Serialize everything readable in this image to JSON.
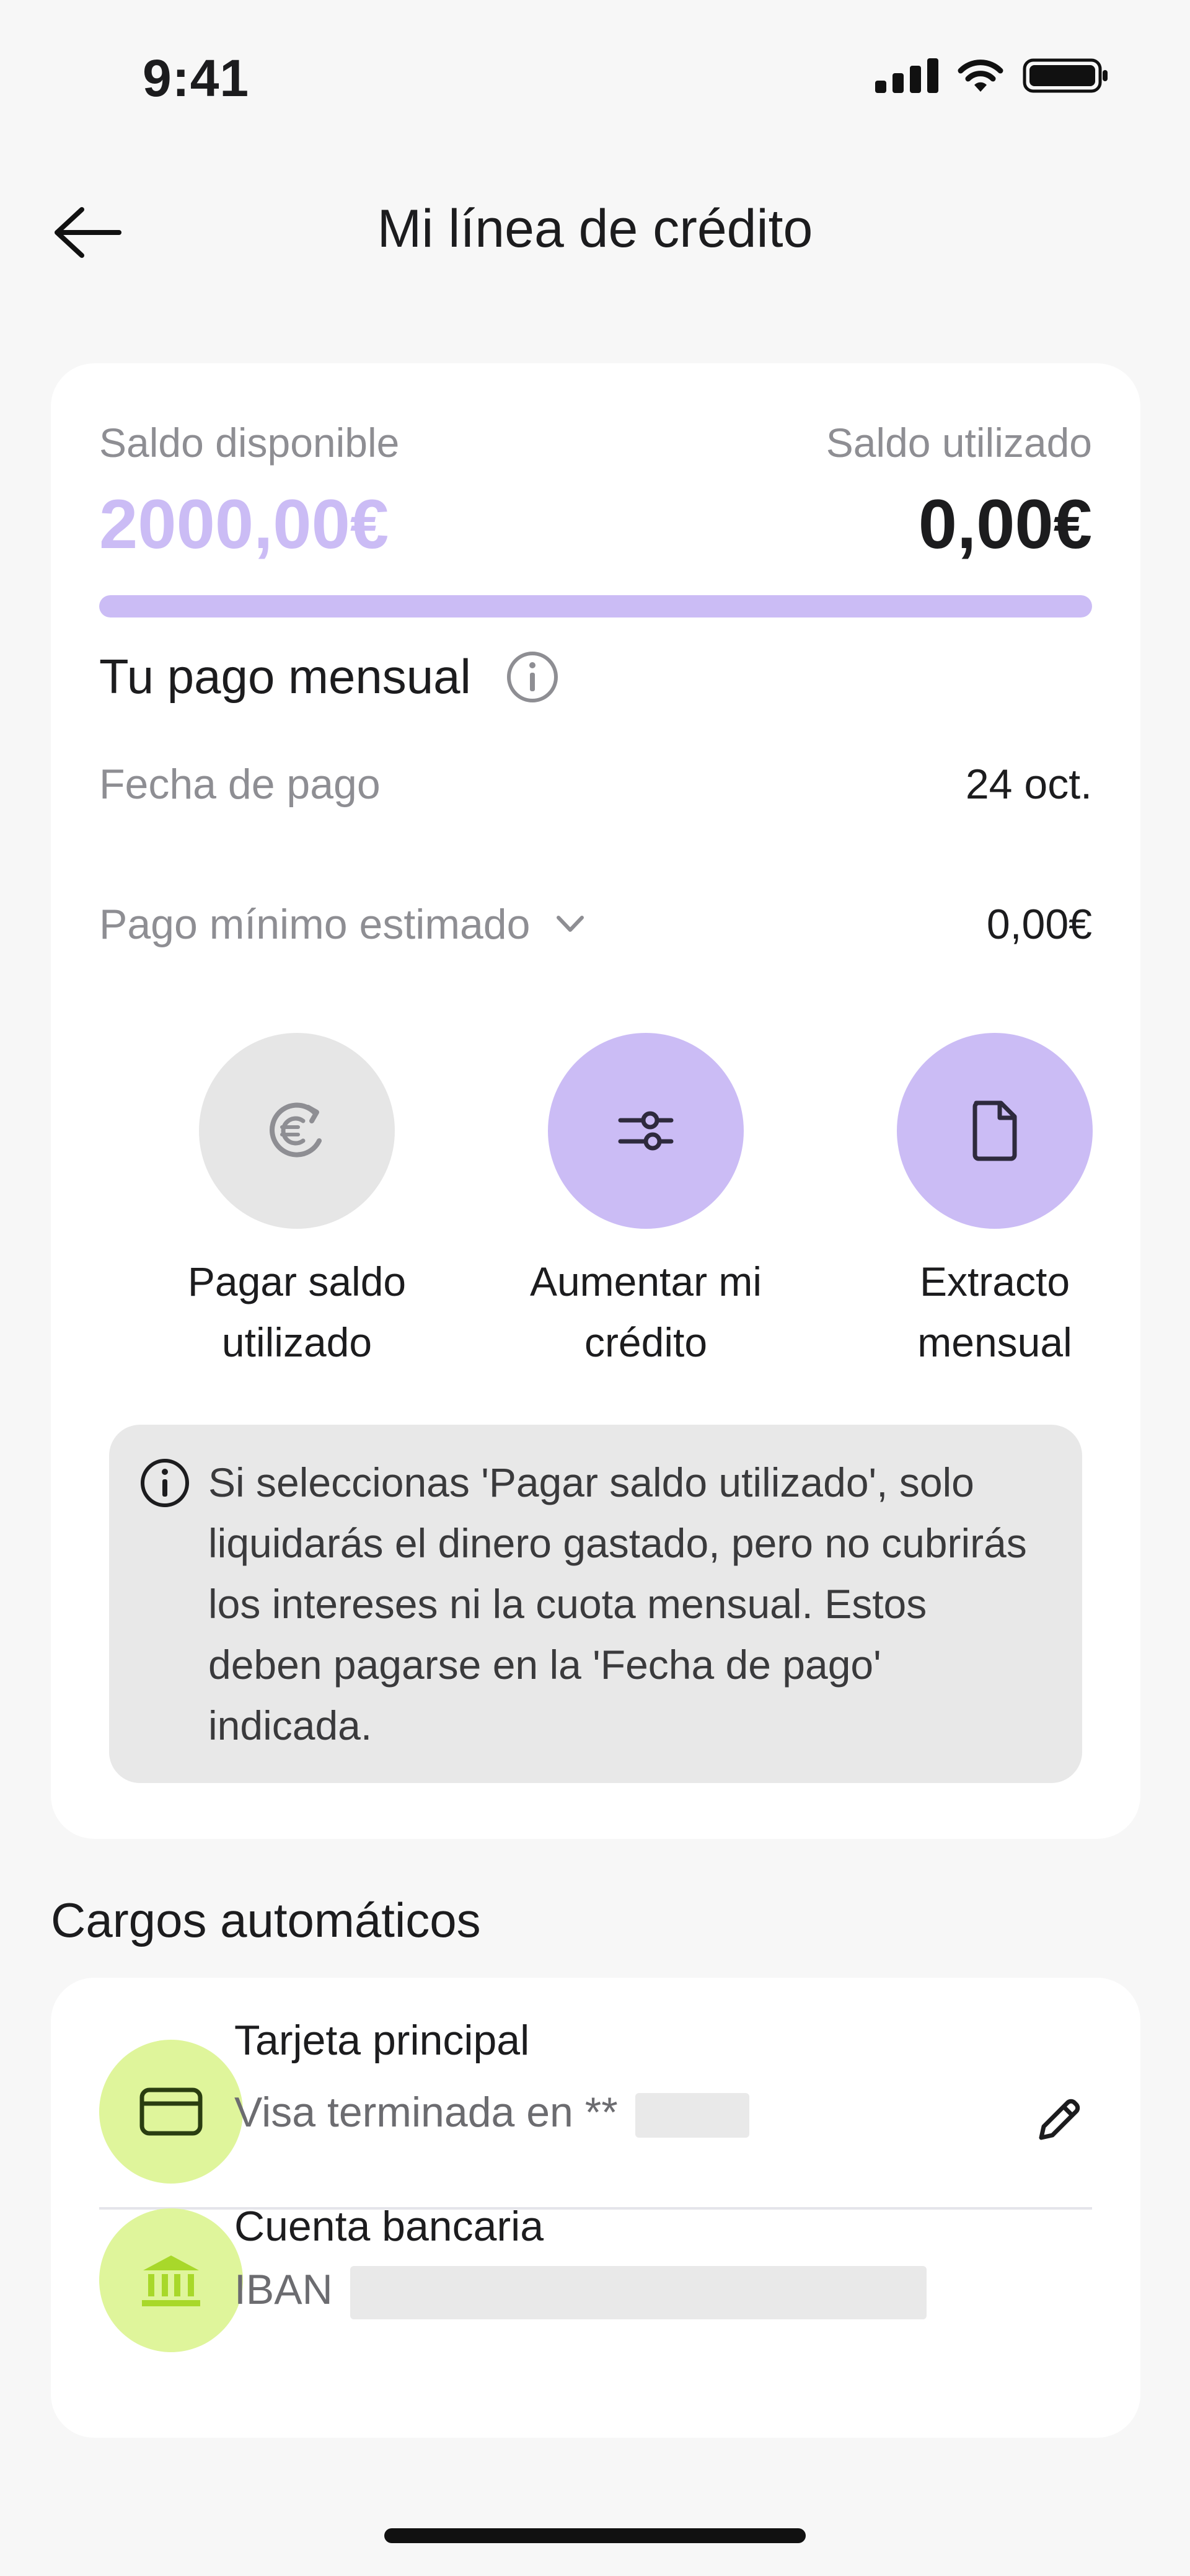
{
  "status_bar": {
    "time": "9:41"
  },
  "header": {
    "title": "Mi línea de crédito"
  },
  "credit": {
    "available_label": "Saldo disponible",
    "available_amount": "2000,00€",
    "used_label": "Saldo utilizado",
    "used_amount": "0,00€",
    "used_fraction": 0
  },
  "monthly": {
    "title": "Tu pago mensual",
    "payment_date_label": "Fecha de pago",
    "payment_date_value": "24 oct.",
    "min_payment_label": "Pago mínimo estimado",
    "min_payment_value": "0,00€"
  },
  "actions": [
    {
      "label_1": "Pagar saldo",
      "label_2": "utilizado",
      "icon": "euro-refresh-icon"
    },
    {
      "label_1": "Aumentar mi",
      "label_2": "crédito",
      "icon": "sliders-icon"
    },
    {
      "label_1": "Extracto",
      "label_2": "mensual",
      "icon": "document-icon"
    }
  ],
  "notice": {
    "text": "Si seleccionas 'Pagar saldo utilizado', solo liquidarás el dinero gastado, pero no cubrirás los intereses ni la cuota mensual. Estos deben pagarse en la 'Fecha de pago' indicada."
  },
  "auto_charges": {
    "title": "Cargos automáticos",
    "card": {
      "title": "Tarjeta principal",
      "subtitle": "Visa terminada en **"
    },
    "bank": {
      "title": "Cuenta bancaria",
      "subtitle": "IBAN"
    }
  },
  "colors": {
    "accent": "#cbbcf5",
    "lime": "#dff59b",
    "background": "#f7f7f7"
  }
}
